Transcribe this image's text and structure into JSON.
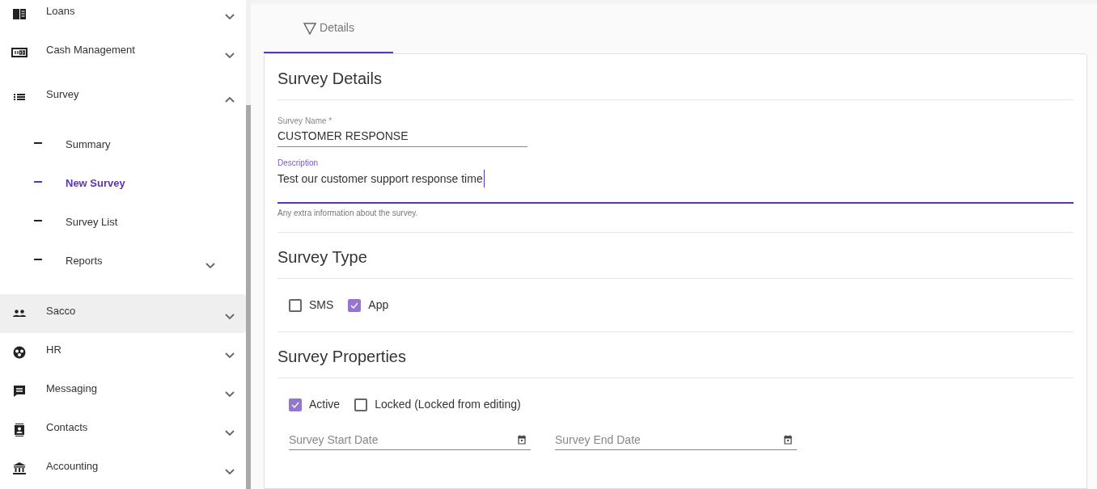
{
  "sidebar": {
    "items": [
      {
        "label": "Loans",
        "expanded": false,
        "hovered": false
      },
      {
        "label": "Cash Management",
        "expanded": false,
        "hovered": false
      },
      {
        "label": "Survey",
        "expanded": true,
        "hovered": false,
        "children": [
          {
            "label": "Summary",
            "selected": false,
            "has_submenu": false
          },
          {
            "label": "New Survey",
            "selected": true,
            "has_submenu": false
          },
          {
            "label": "Survey List",
            "selected": false,
            "has_submenu": false
          },
          {
            "label": "Reports",
            "selected": false,
            "has_submenu": true
          }
        ]
      },
      {
        "label": "Sacco",
        "expanded": false,
        "hovered": true
      },
      {
        "label": "HR",
        "expanded": false,
        "hovered": false
      },
      {
        "label": "Messaging",
        "expanded": false,
        "hovered": false
      },
      {
        "label": "Contacts",
        "expanded": false,
        "hovered": false
      },
      {
        "label": "Accounting",
        "expanded": false,
        "hovered": false
      }
    ]
  },
  "tabs": [
    {
      "label": "Details",
      "selected": true
    }
  ],
  "sections": [
    {
      "title": "Survey Details",
      "kind": "fields",
      "fields": [
        {
          "label": "Survey Name *",
          "value": "CUSTOMER RESPONSE",
          "focused": false
        },
        {
          "label": "Description",
          "value": "Test our customer support response time",
          "focused": true,
          "hint": "Any extra information about the survey."
        }
      ]
    },
    {
      "title": "Survey Type",
      "kind": "checkboxes",
      "checkboxes": [
        {
          "label": "SMS",
          "checked": false
        },
        {
          "label": "App",
          "checked": true
        }
      ]
    },
    {
      "title": "Survey Properties",
      "kind": "properties",
      "checkboxes": [
        {
          "label": "Active",
          "checked": true
        },
        {
          "label": "Locked (Locked from editing)",
          "checked": false
        }
      ],
      "dates": [
        {
          "placeholder": "Survey Start Date"
        },
        {
          "placeholder": "Survey End Date"
        }
      ]
    }
  ]
}
